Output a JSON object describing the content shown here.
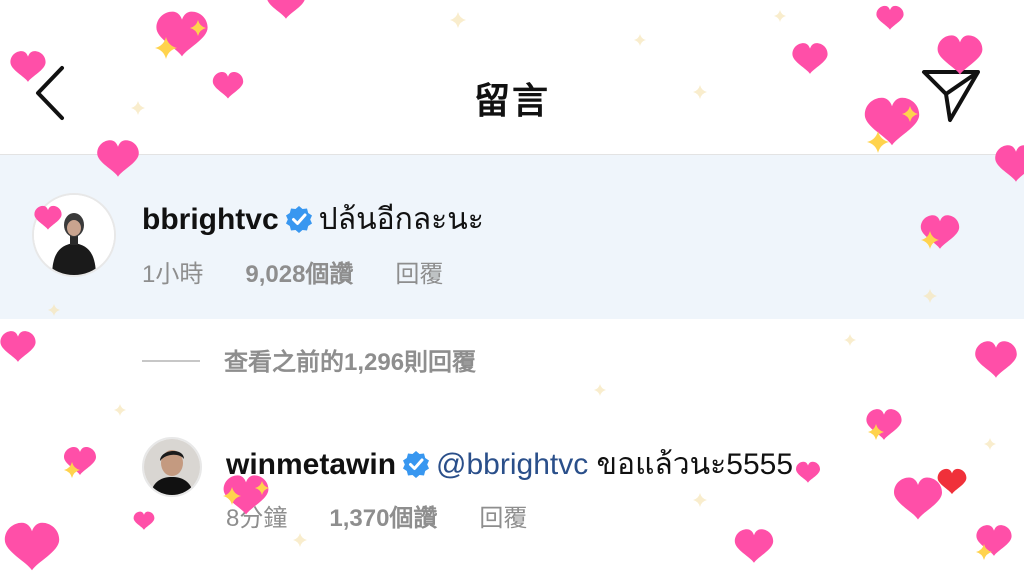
{
  "header": {
    "title": "留言",
    "back_icon": "chevron-left-icon",
    "send_icon": "paper-plane-icon"
  },
  "caption": {
    "username": "bbrightvc",
    "verified": true,
    "text": "ปล้นอีกละนะ",
    "time": "1小時",
    "likes": "9,028個讚",
    "reply_label": "回覆"
  },
  "view_previous": "查看之前的1,296則回覆",
  "reply_comment": {
    "username": "winmetawin",
    "verified": true,
    "mention": "@bbrightvc",
    "text": " ขอแล้วนะ5555",
    "time": "8分鐘",
    "likes": "1,370個讚",
    "reply_label": "回覆"
  },
  "colors": {
    "heart_pink": "#ff4fa8",
    "heart_red": "#f0303a",
    "verified_blue": "#3897f0",
    "caption_bg": "#eff5fb"
  }
}
